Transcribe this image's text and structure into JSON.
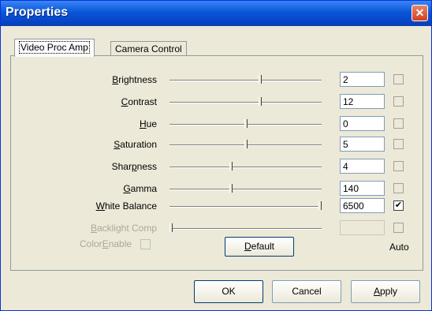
{
  "window": {
    "title": "Properties"
  },
  "tabs": [
    {
      "label": "Video Proc Amp",
      "active": true
    },
    {
      "label": "Camera Control",
      "active": false
    }
  ],
  "rows": [
    {
      "label_pre": "",
      "label_key": "B",
      "label_post": "rightness",
      "value": "2",
      "slider_fraction": 0.6,
      "auto": false,
      "disabled": false
    },
    {
      "label_pre": "",
      "label_key": "C",
      "label_post": "ontrast",
      "value": "12",
      "slider_fraction": 0.6,
      "auto": false,
      "disabled": false
    },
    {
      "label_pre": "",
      "label_key": "H",
      "label_post": "ue",
      "value": "0",
      "slider_fraction": 0.5,
      "auto": false,
      "disabled": false
    },
    {
      "label_pre": "",
      "label_key": "S",
      "label_post": "aturation",
      "value": "5",
      "slider_fraction": 0.5,
      "auto": false,
      "disabled": false
    },
    {
      "label_pre": "Shar",
      "label_key": "p",
      "label_post": "ness",
      "value": "4",
      "slider_fraction": 0.4,
      "auto": false,
      "disabled": false
    },
    {
      "label_pre": "",
      "label_key": "G",
      "label_post": "amma",
      "value": "140",
      "slider_fraction": 0.4,
      "auto": false,
      "disabled": false
    },
    {
      "label_pre": "",
      "label_key": "W",
      "label_post": "hite Balance",
      "value": "6500",
      "slider_fraction": 1.0,
      "auto": true,
      "disabled": false
    },
    {
      "label_pre": "",
      "label_key": "B",
      "label_post": "acklight Comp",
      "value": "",
      "slider_fraction": 0.0,
      "auto": false,
      "disabled": true
    }
  ],
  "color_enable": {
    "pre": "Color",
    "key": "E",
    "post": "nable"
  },
  "default_button": {
    "pre": "",
    "key": "D",
    "post": "efault"
  },
  "auto_header": "Auto",
  "footer": {
    "ok": "OK",
    "cancel": "Cancel",
    "apply_pre": "",
    "apply_key": "A",
    "apply_post": "pply"
  },
  "colors": {
    "titlebar": "#0a56d8",
    "window_bg": "#ece9d8",
    "close": "#d4401e"
  }
}
